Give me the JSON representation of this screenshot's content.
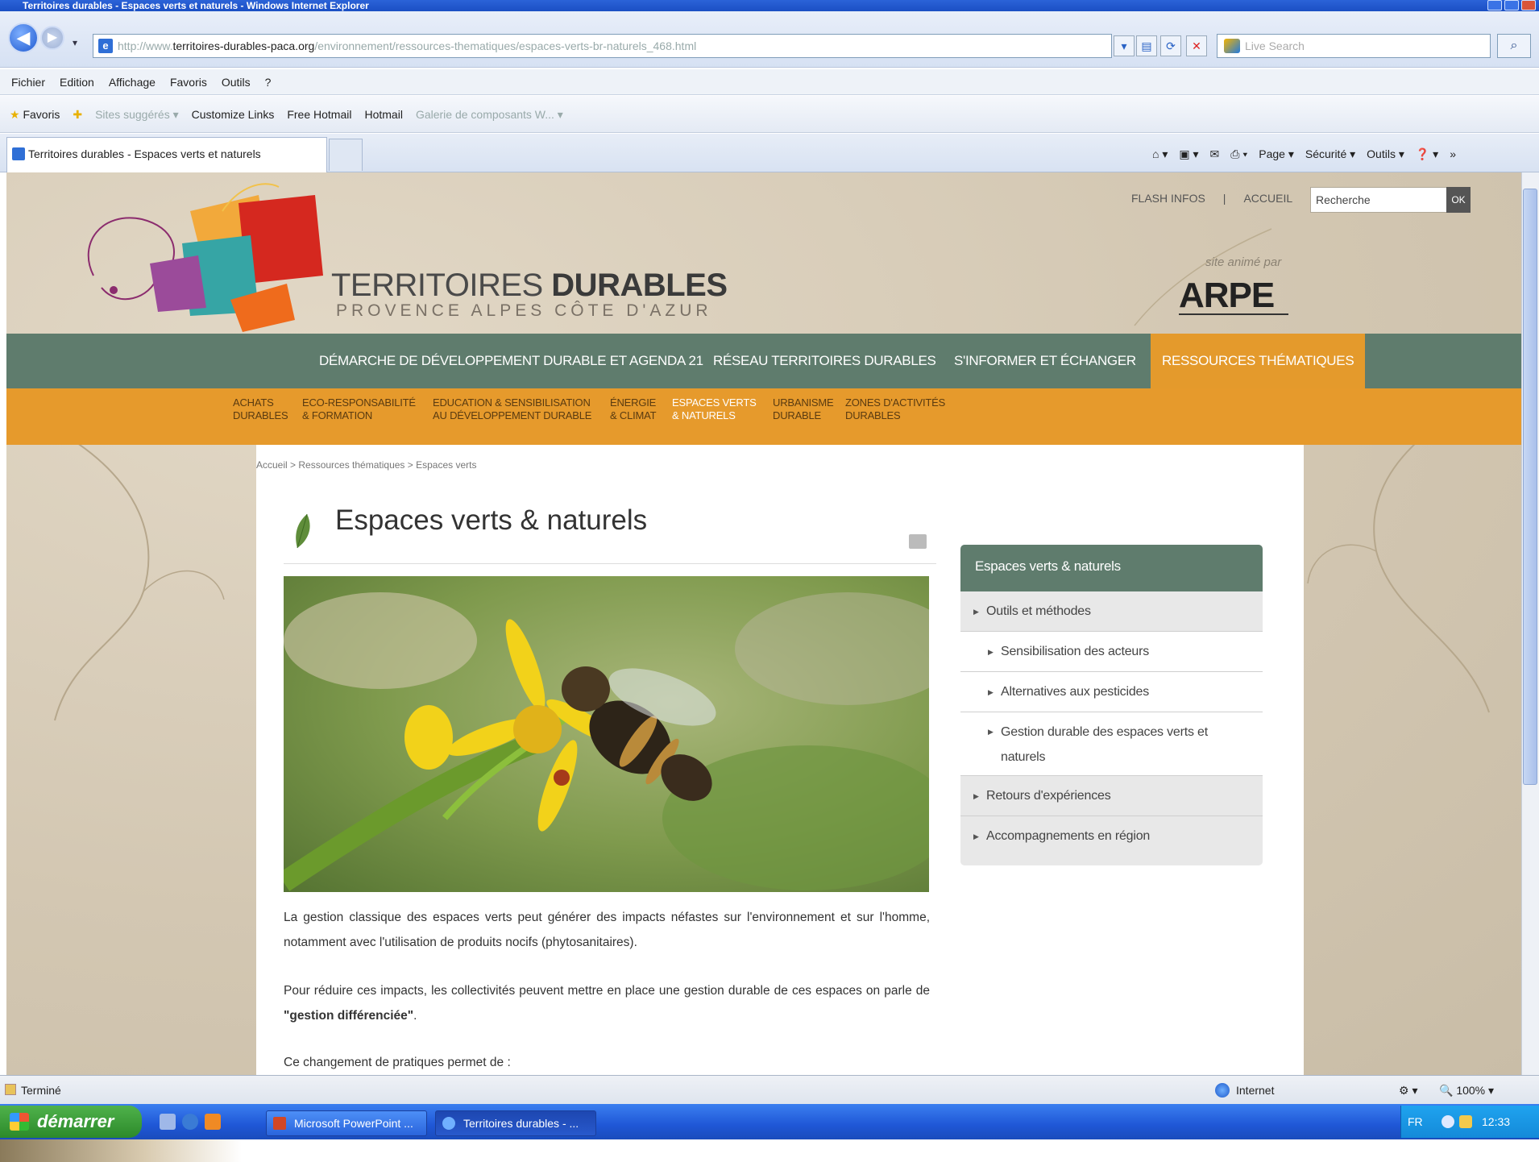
{
  "window": {
    "title": "Territoires durables - Espaces verts et naturels - Windows Internet Explorer"
  },
  "browser": {
    "address_host": "territoires-durables-paca.org",
    "address_prefix": "http://www.",
    "address_path": "/environnement/ressources-thematiques/espaces-verts-br-naturels_468.html",
    "live_search_placeholder": "Live Search",
    "menu": [
      "Fichier",
      "Edition",
      "Affichage",
      "Favoris",
      "Outils",
      "?"
    ],
    "favorites": {
      "favoris": "Favoris",
      "sites": "Sites suggérés ▾",
      "customize": "Customize Links",
      "free_hotmail": "Free Hotmail",
      "hotmail": "Hotmail",
      "galerie": "Galerie de composants W... ▾"
    },
    "tab_title": "Territoires durables - Espaces verts et naturels",
    "commands": {
      "page": "Page ▾",
      "securite": "Sécurité ▾",
      "outils": "Outils ▾",
      "more": "»"
    }
  },
  "site": {
    "title_light": "TERRITOIRES ",
    "title_bold": "DURABLES",
    "subtitle": "PROVENCE ALPES CÔTE D'AZUR",
    "toplinks": {
      "flash": "FLASH INFOS",
      "sep": "|",
      "accueil": "ACCUEIL"
    },
    "search_value": "Recherche",
    "ok_label": "OK",
    "anime_par": "site animé par",
    "arpe": "ARPE"
  },
  "mainnav": [
    "DÉMARCHE DE DÉVELOPPEMENT DURABLE ET AGENDA 21",
    "RÉSEAU TERRITOIRES DURABLES",
    "S'INFORMER ET ÉCHANGER",
    "RESSOURCES THÉMATIQUES"
  ],
  "subnav": [
    "ACHATS\nDURABLES",
    "ECO-RESPONSABILITÉ\n& FORMATION",
    "EDUCATION & SENSIBILISATION\nAU DÉVELOPPEMENT DURABLE",
    "ÉNERGIE\n& CLIMAT",
    "ESPACES VERTS\n& NATURELS",
    "URBANISME\nDURABLE",
    "ZONES D'ACTIVITÉS\nDURABLES"
  ],
  "breadcrumb": "Accueil  >  Ressources thématiques  >  Espaces verts",
  "page_title": "Espaces verts & naturels",
  "paragraphs": [
    "La gestion classique des espaces verts peut générer des impacts néfastes sur l'environnement et sur l'homme, notamment avec l'utilisation de produits nocifs (phytosanitaires).",
    "Pour réduire ces impacts, les collectivités peuvent mettre en place une gestion durable de ces espaces on parle de",
    "\"gestion différenciée\"",
    ".",
    "Ce changement de pratiques permet de :"
  ],
  "sidemenu": {
    "heading": "Espaces verts & naturels",
    "items": [
      "Outils et méthodes",
      "Sensibilisation des acteurs",
      "Alternatives aux pesticides",
      "Gestion durable des espaces verts et naturels",
      "Retours d'expériences",
      "Accompagnements en région"
    ]
  },
  "status": {
    "text": "Terminé",
    "zone": "Internet",
    "zoom": "100%"
  },
  "taskbar": {
    "start": "démarrer",
    "items": [
      "Microsoft PowerPoint ...",
      "Territoires durables - ..."
    ],
    "lang": "FR",
    "time": "12:33"
  },
  "colors": {
    "nav_green": "#5f7c6d",
    "accent_orange": "#e69a2c"
  }
}
